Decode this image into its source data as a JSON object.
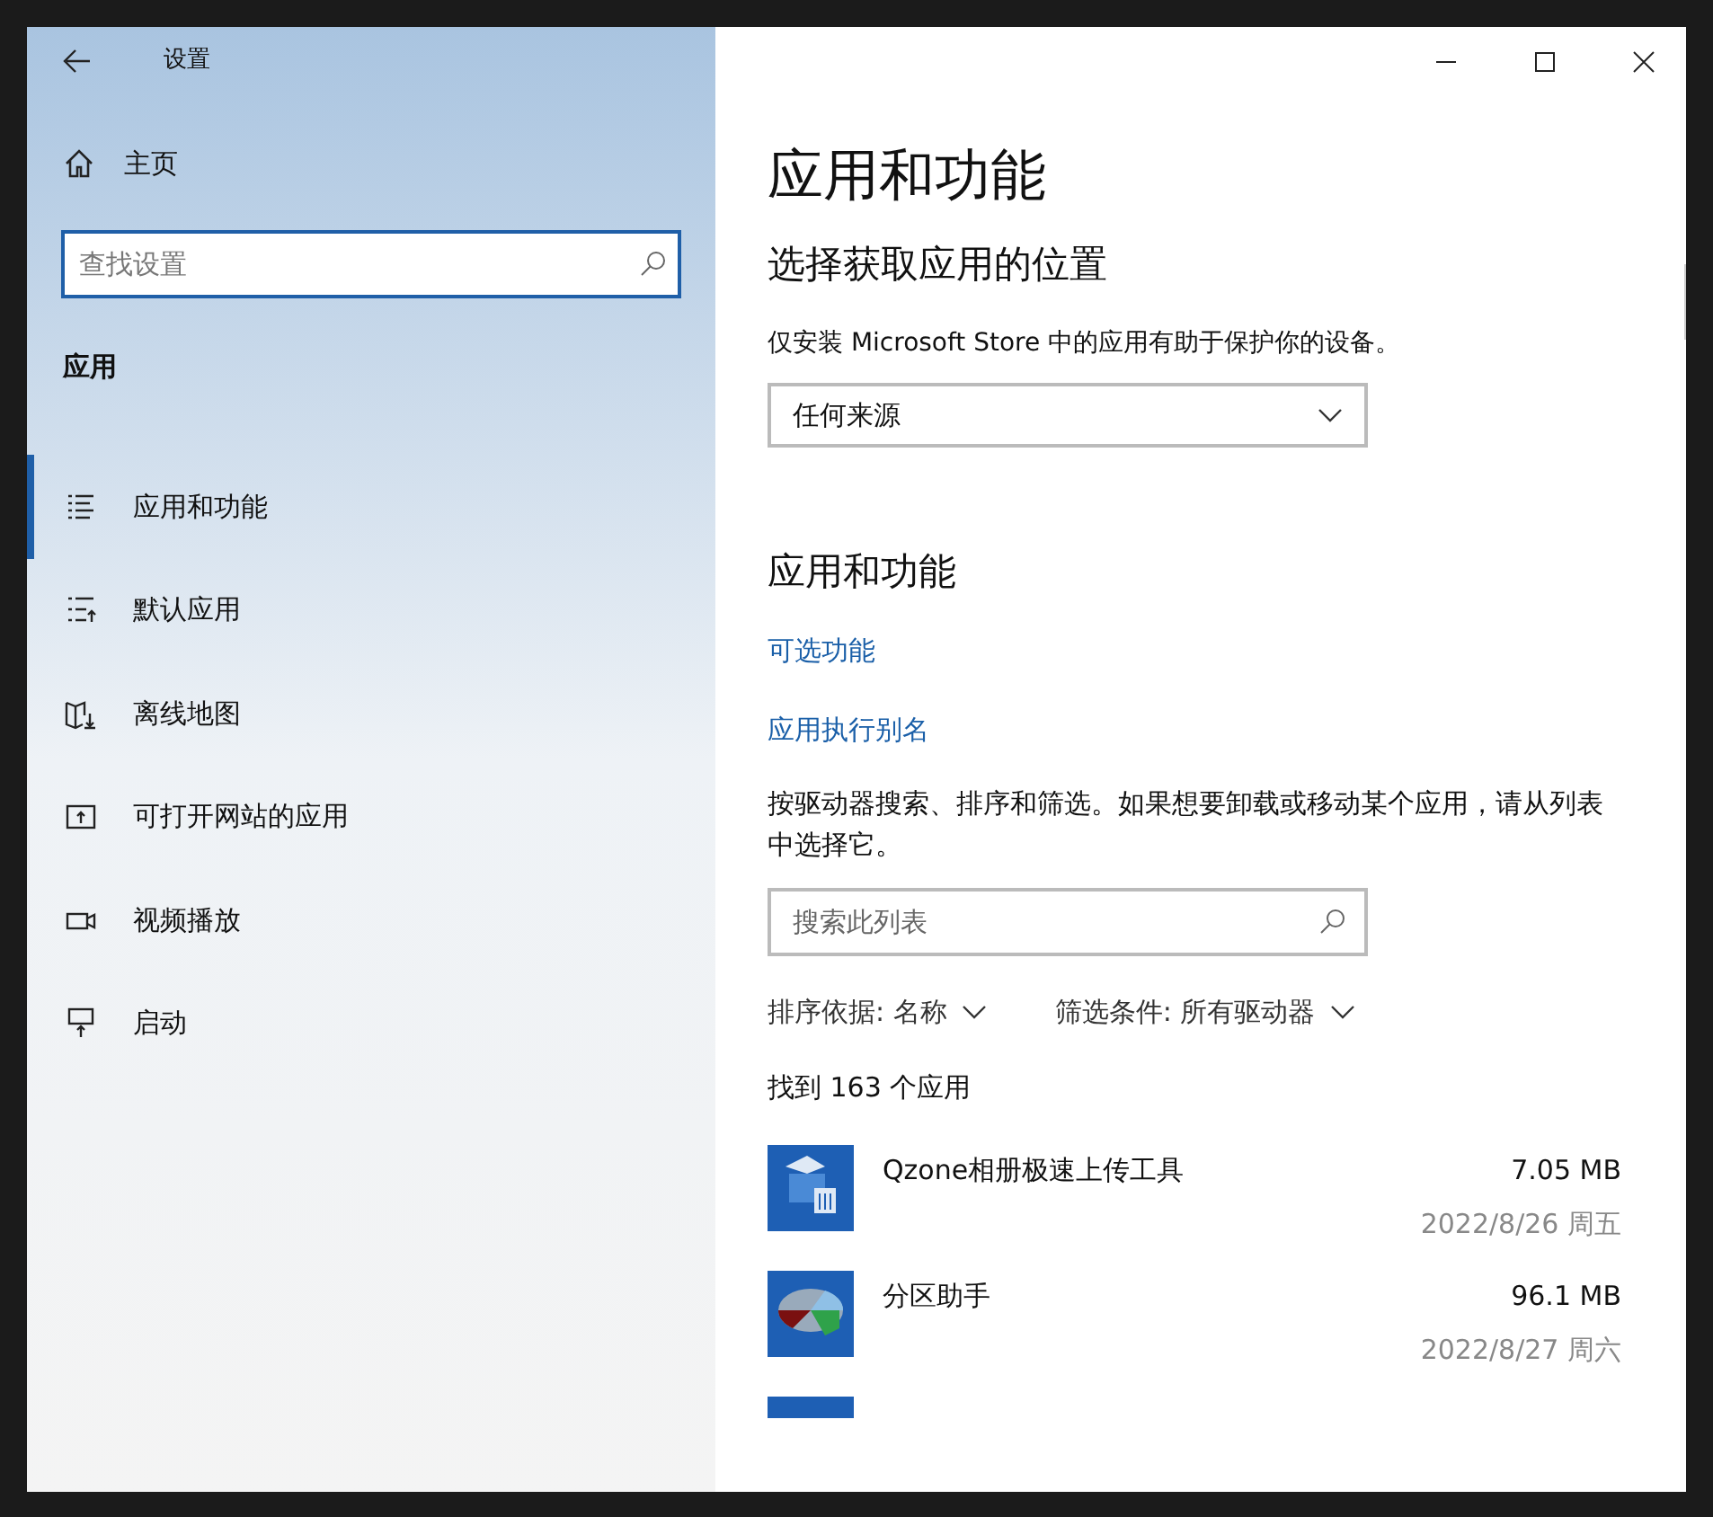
{
  "window": {
    "title": "设置"
  },
  "sidebar": {
    "home": "主页",
    "search": {
      "placeholder": "查找设置"
    },
    "section": "应用",
    "items": [
      {
        "kind": "list",
        "label": "应用和功能",
        "selected": true
      },
      {
        "kind": "default",
        "label": "默认应用",
        "selected": false
      },
      {
        "kind": "map",
        "label": "离线地图",
        "selected": false
      },
      {
        "kind": "web",
        "label": "可打开网站的应用",
        "selected": false
      },
      {
        "kind": "video",
        "label": "视频播放",
        "selected": false
      },
      {
        "kind": "startup",
        "label": "启动",
        "selected": false
      }
    ]
  },
  "main": {
    "title": "应用和功能",
    "source_heading": "选择获取应用的位置",
    "source_note": "仅安装 Microsoft Store 中的应用有助于保护你的设备。",
    "source_dropdown": "任何来源",
    "apps_heading": "应用和功能",
    "links": [
      "可选功能",
      "应用执行别名"
    ],
    "hint": "按驱动器搜索、排序和筛选。如果想要卸载或移动某个应用，请从列表中选择它。",
    "list_search": {
      "placeholder": "搜索此列表"
    },
    "sort": {
      "label": "排序依据:",
      "value": "名称"
    },
    "filter": {
      "label": "筛选条件:",
      "value": "所有驱动器"
    },
    "count": "找到 163 个应用",
    "apps": [
      {
        "kind": "upload",
        "name": "Qzone相册极速上传工具",
        "size": "7.05 MB",
        "date": "2022/8/26 周五"
      },
      {
        "kind": "partition",
        "name": "分区助手",
        "size": "96.1 MB",
        "date": "2022/8/27 周六"
      },
      {
        "kind": "blank"
      }
    ]
  }
}
